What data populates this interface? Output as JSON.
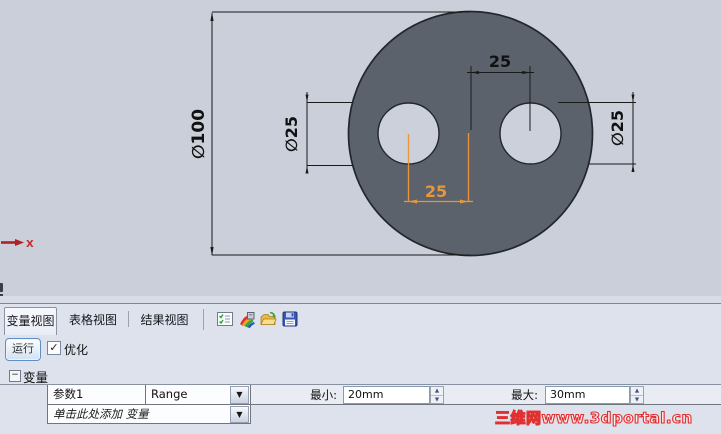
{
  "drawing": {
    "labels": {
      "outer_diameter": "∅100",
      "left_hole_diameter": "∅25",
      "right_hole_diameter": "∅25",
      "hole_spacing_top": "25",
      "hole_spacing_bottom": "25",
      "axis_x": "X"
    },
    "colors": {
      "background": "#cacfd9",
      "part_fill": "#5c626b",
      "part_edge": "#23262b",
      "dimension": "#1a1a1a",
      "highlight_dimension": "#e8963c",
      "axis": "#b02025"
    }
  },
  "panel": {
    "tabs": [
      {
        "label": "变量视图",
        "active": true
      },
      {
        "label": "表格视图",
        "active": false
      },
      {
        "label": "结果视图",
        "active": false
      }
    ],
    "toolbar_icons": [
      "design-study-settings",
      "results-report",
      "open-folder",
      "save"
    ],
    "run_button": "运行",
    "optimize": {
      "label": "优化",
      "checked": true
    },
    "variables_section": {
      "title": "变量"
    },
    "variable_row": {
      "name": "参数1",
      "type": "Range",
      "min_label": "最小:",
      "min_value": "20mm",
      "max_label": "最大:",
      "max_value": "30mm"
    },
    "add_variable_row": {
      "text": "单击此处添加 变量"
    }
  },
  "glyphs": {
    "dropdown": "▼",
    "spinner_up": "▲",
    "spinner_down": "▼",
    "checkbox_check": "✓",
    "collapse_minus": "−"
  },
  "watermark": "三维网www.3dportal.cn"
}
